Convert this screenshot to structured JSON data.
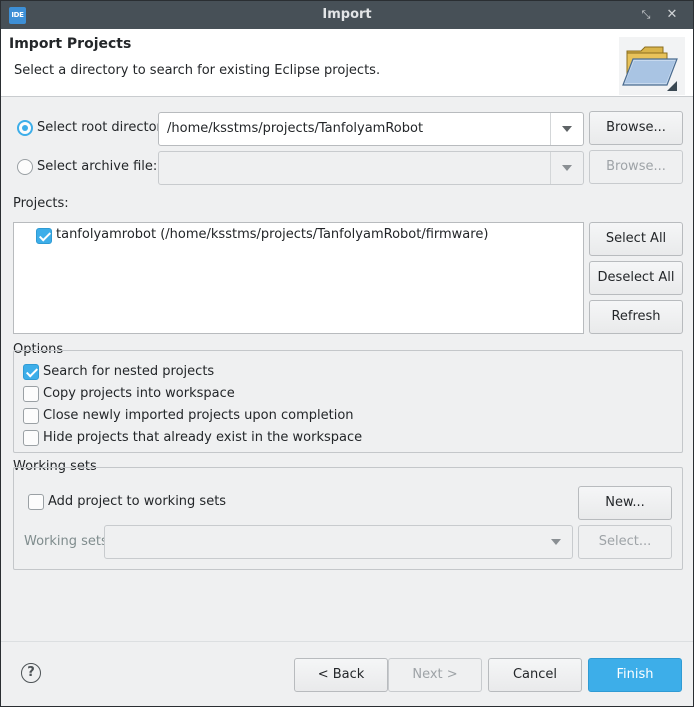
{
  "window": {
    "title": "Import",
    "app_icon": "IDE"
  },
  "header": {
    "title": "Import Projects",
    "subtitle": "Select a directory to search for existing Eclipse projects."
  },
  "source": {
    "root_label": "Select root directory:",
    "root_value": "/home/ksstms/projects/TanfolyamRobot",
    "root_selected": true,
    "archive_label": "Select archive file:",
    "archive_value": "",
    "browse_label": "Browse..."
  },
  "projects": {
    "label": "Projects:",
    "items": [
      {
        "label": "tanfolyamrobot (/home/ksstms/projects/TanfolyamRobot/firmware)",
        "checked": true
      }
    ],
    "select_all": "Select All",
    "deselect_all": "Deselect All",
    "refresh": "Refresh"
  },
  "options": {
    "title": "Options",
    "items": [
      {
        "label": "Search for nested projects",
        "checked": true
      },
      {
        "label": "Copy projects into workspace",
        "checked": false
      },
      {
        "label": "Close newly imported projects upon completion",
        "checked": false
      },
      {
        "label": "Hide projects that already exist in the workspace",
        "checked": false
      }
    ]
  },
  "working_sets": {
    "title": "Working sets",
    "add_label": "Add project to working sets",
    "add_checked": false,
    "new_label": "New...",
    "sets_label": "Working sets:",
    "sets_value": "",
    "select_label": "Select..."
  },
  "footer": {
    "help_icon": "question-mark-icon",
    "back": "< Back",
    "next": "Next >",
    "cancel": "Cancel",
    "finish": "Finish"
  },
  "colors": {
    "accent": "#3daee9",
    "titlebar": "#475057",
    "window_bg": "#eff0f1"
  }
}
